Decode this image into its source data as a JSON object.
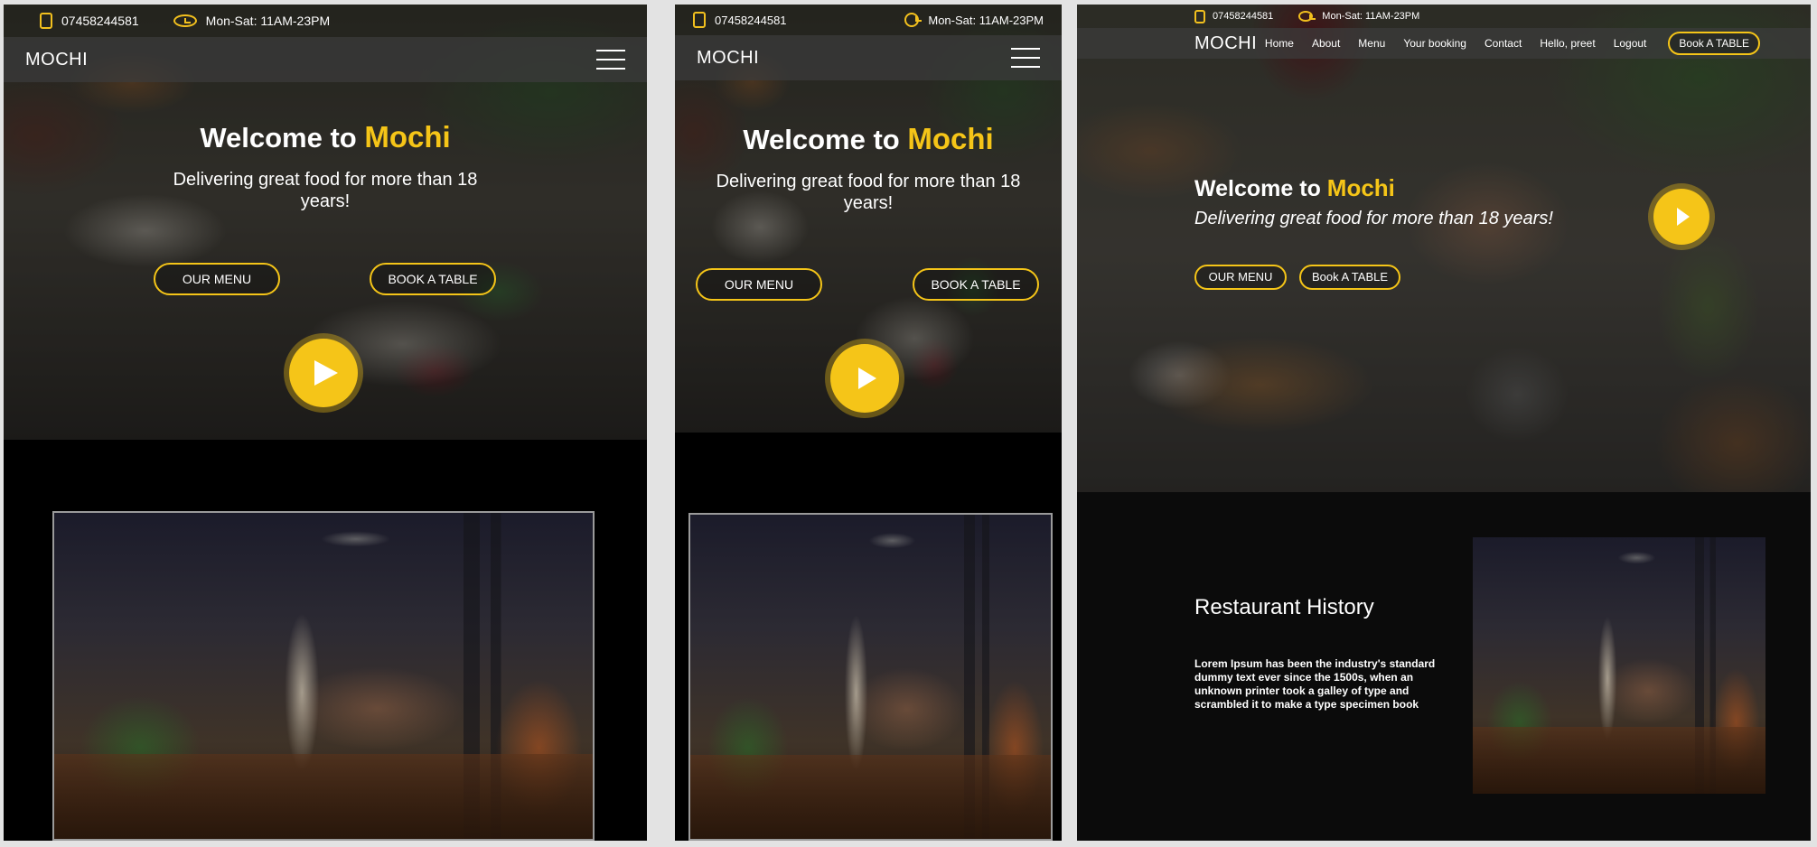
{
  "brand": "MOCHI",
  "contact": {
    "phone": "07458244581",
    "hours": "Mon-Sat: 11AM-23PM"
  },
  "hero": {
    "welcome": "Welcome to",
    "name": "Mochi",
    "tagline_mobile": "Delivering great food for more than 18 years!",
    "tagline_desktop": "Delivering great food for more than 18 years!",
    "our_menu_caps": "OUR MENU",
    "book_table_caps": "BOOK A TABLE",
    "our_menu": "OUR MENU",
    "book_table": "Book A TABLE"
  },
  "nav": {
    "items": [
      "Home",
      "About",
      "Menu",
      "Your booking",
      "Contact",
      "Hello, preet",
      "Logout"
    ],
    "cta": "Book A TABLE"
  },
  "history": {
    "title": "Restaurant History",
    "text": "Lorem Ipsum has been the industry's standard dummy text ever since the 1500s, when an unknown printer took a galley of type and scrambled it to make a type specimen book"
  },
  "colors": {
    "accent": "#f5c518",
    "background": "#000000"
  }
}
